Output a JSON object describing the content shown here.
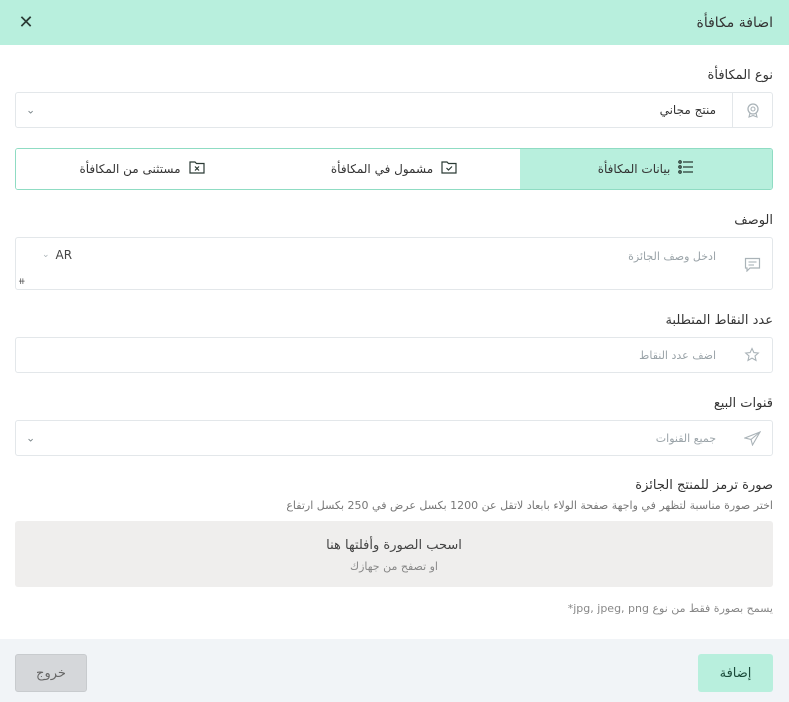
{
  "header": {
    "title": "اضافة مكافأة",
    "close_glyph": "✕"
  },
  "reward_type": {
    "label": "نوع المكافأة",
    "value": "منتج مجاني",
    "icon": "badge-icon"
  },
  "tabs": [
    {
      "label": "بيانات المكافأة",
      "icon": "list-icon",
      "active": true
    },
    {
      "label": "مشمول في المكافأة",
      "icon": "folder-check-icon",
      "active": false
    },
    {
      "label": "مستثنى من المكافأة",
      "icon": "folder-x-icon",
      "active": false
    }
  ],
  "description": {
    "label": "الوصف",
    "placeholder": "ادخل وصف الجائزة",
    "lang": "AR"
  },
  "points": {
    "label": "عدد النقاط المتطلبة",
    "placeholder": "اضف عدد النقاط"
  },
  "channels": {
    "label": "قنوات البيع",
    "placeholder": "جميع القنوات"
  },
  "image": {
    "label": "صورة ترمز للمنتج الجائزة",
    "hint": "اختر صورة مناسبة لتظهر في واجهة صفحة الولاء بابعاد لاتقل عن 1200 بكسل عرض في 250 بكسل ارتفاع",
    "drop_main": "اسحب الصورة وأفلتها هنا",
    "drop_sub": "او تصفح من جهازك",
    "note": "يسمح بصورة فقط من نوع jpg, jpeg, png*"
  },
  "footer": {
    "add_label": "إضافة",
    "exit_label": "خروج"
  },
  "colors": {
    "accent": "#b8efdd",
    "border": "#e3e7ea"
  }
}
